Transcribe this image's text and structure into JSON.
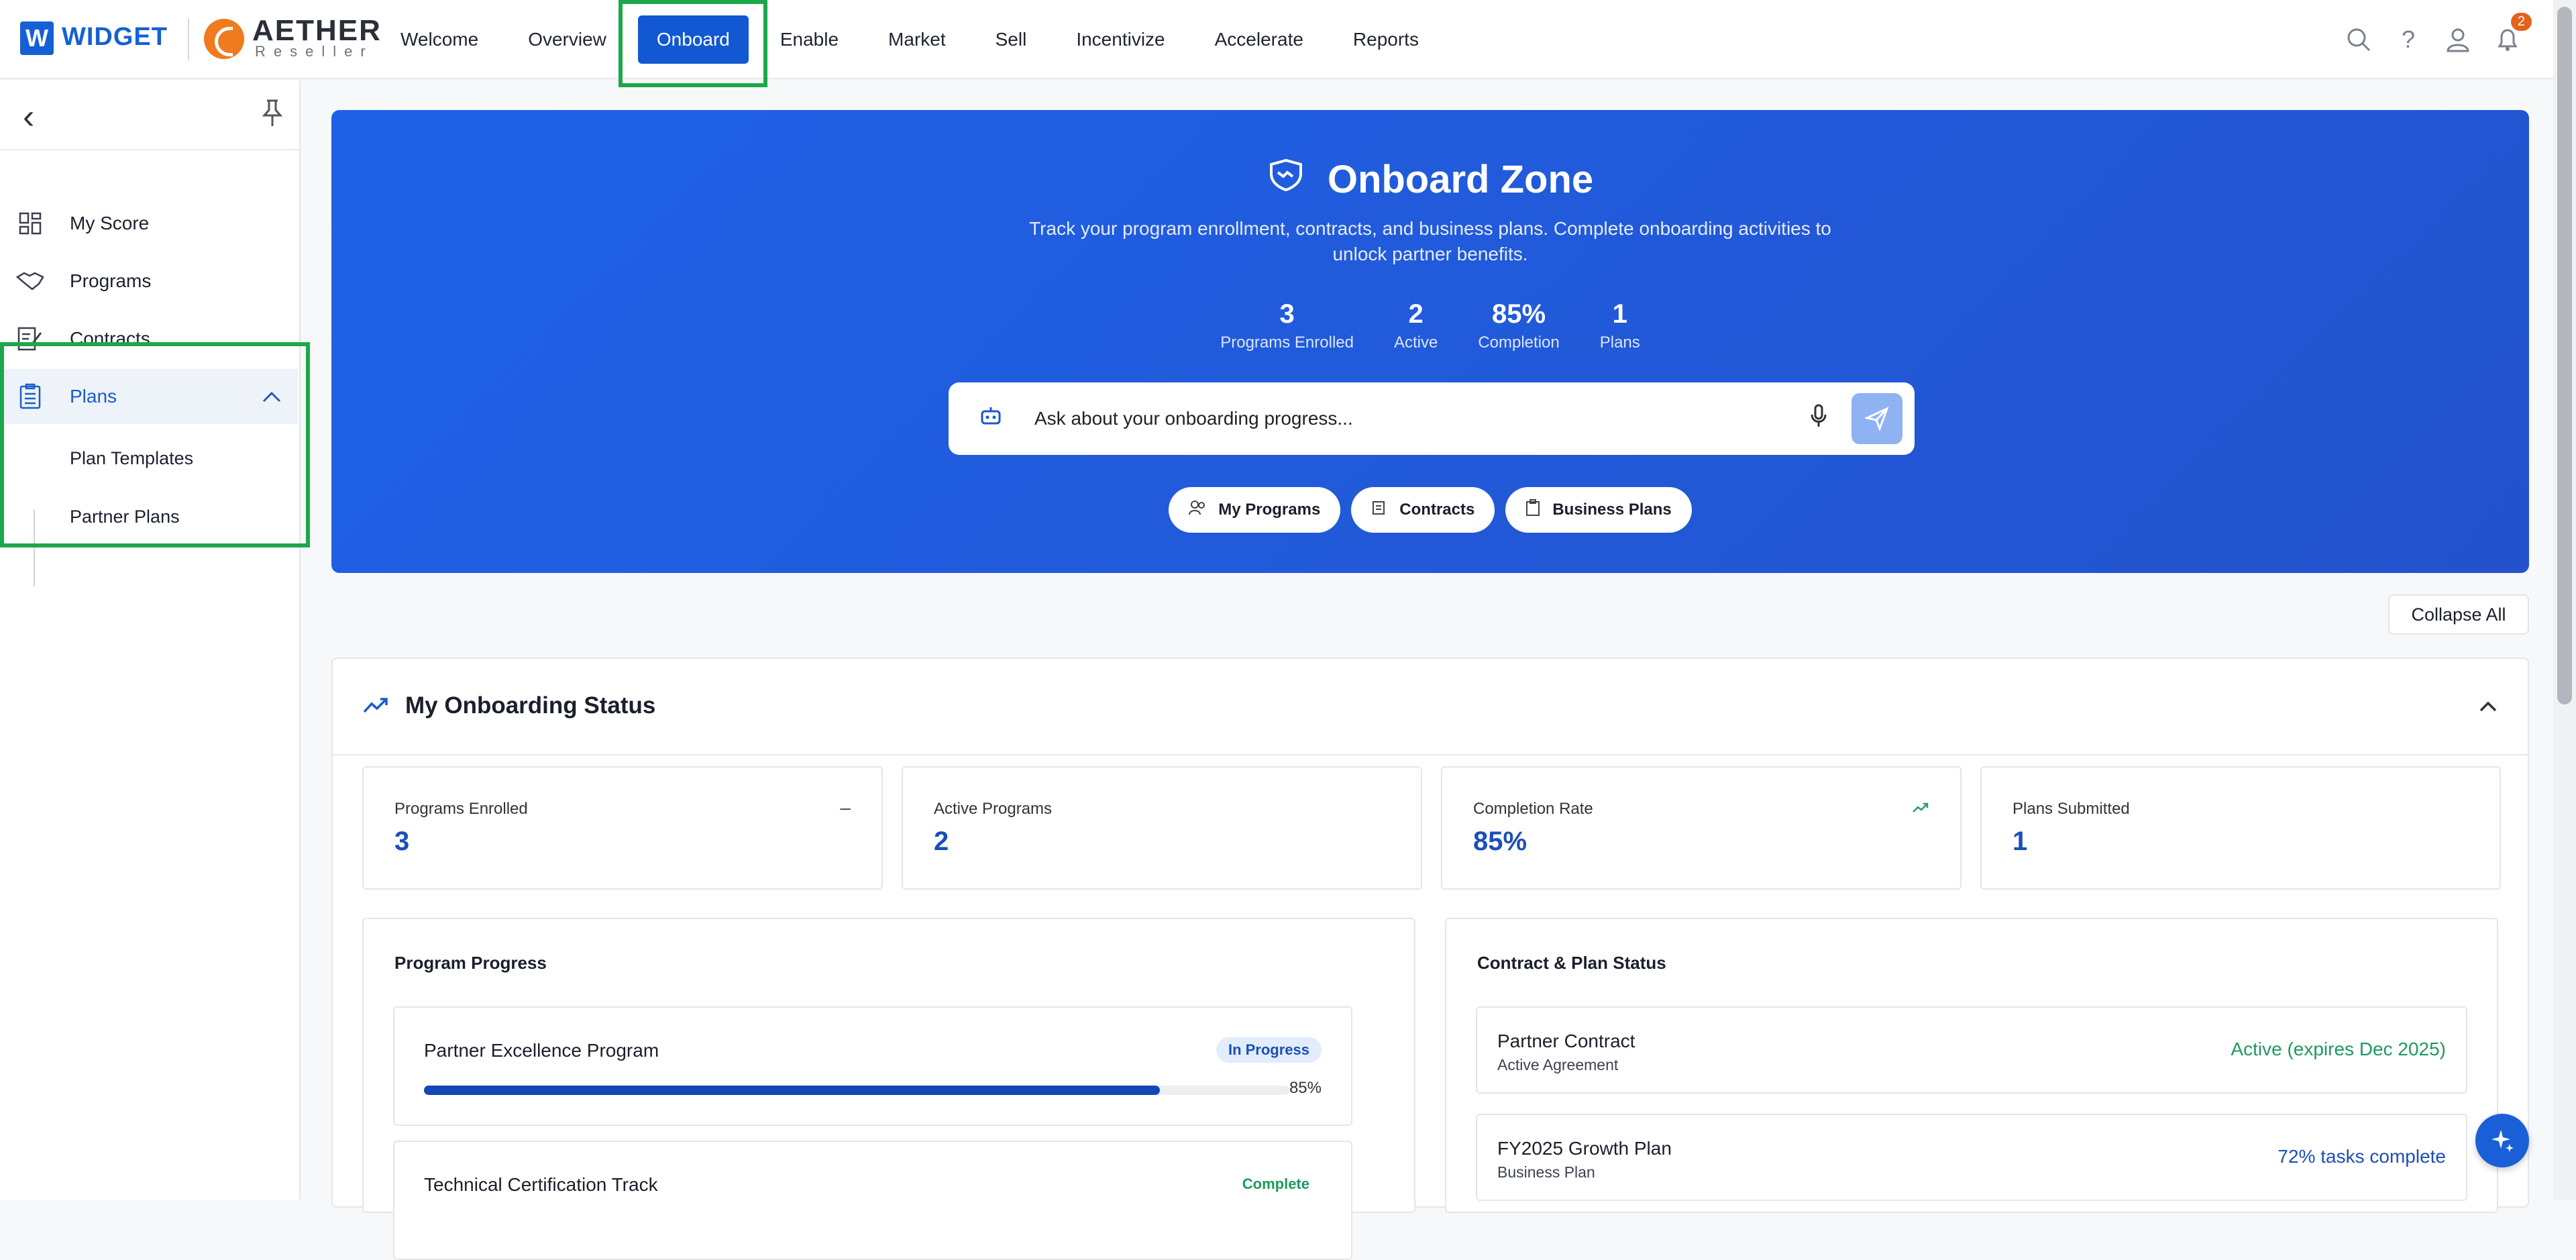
{
  "brand": {
    "widget_letter": "W",
    "widget_name": "WIDGET",
    "aether_name": "AETHER",
    "aether_sub": "Reseller"
  },
  "nav": {
    "items": [
      {
        "label": "Welcome"
      },
      {
        "label": "Overview"
      },
      {
        "label": "Onboard",
        "active": true
      },
      {
        "label": "Enable"
      },
      {
        "label": "Market"
      },
      {
        "label": "Sell"
      },
      {
        "label": "Incentivize"
      },
      {
        "label": "Accelerate"
      },
      {
        "label": "Reports"
      }
    ],
    "notification_count": "2"
  },
  "sidebar": {
    "items": [
      {
        "label": "My Score",
        "icon": "dashboard-icon"
      },
      {
        "label": "Programs",
        "icon": "handshake-icon"
      },
      {
        "label": "Contracts",
        "icon": "contract-icon"
      },
      {
        "label": "Plans",
        "icon": "clipboard-icon"
      }
    ],
    "subitems": [
      {
        "label": "Plan Templates"
      },
      {
        "label": "Partner Plans"
      }
    ]
  },
  "hero": {
    "title": "Onboard Zone",
    "description": "Track your program enrollment, contracts, and business plans. Complete onboarding activities to unlock partner benefits.",
    "stats": [
      {
        "value": "3",
        "label": "Programs Enrolled"
      },
      {
        "value": "2",
        "label": "Active"
      },
      {
        "value": "85%",
        "label": "Completion"
      },
      {
        "value": "1",
        "label": "Plans"
      }
    ],
    "search_placeholder": "Ask about your onboarding progress...",
    "chips": [
      {
        "label": "My Programs",
        "icon": "users-icon"
      },
      {
        "label": "Contracts",
        "icon": "scroll-icon"
      },
      {
        "label": "Business Plans",
        "icon": "clipboard-icon"
      }
    ]
  },
  "collapse_all": "Collapse All",
  "status": {
    "title": "My Onboarding Status",
    "metrics": [
      {
        "label": "Programs Enrolled",
        "value": "3",
        "icon": "–"
      },
      {
        "label": "Active Programs",
        "value": "2",
        "icon": ""
      },
      {
        "label": "Completion Rate",
        "value": "85%",
        "icon": "trend-up"
      },
      {
        "label": "Plans Submitted",
        "value": "1",
        "icon": ""
      }
    ],
    "program_progress": {
      "title": "Program Progress",
      "items": [
        {
          "name": "Partner Excellence Program",
          "status": "In Progress",
          "progress": 85,
          "progress_label": "85%"
        },
        {
          "name": "Technical Certification Track",
          "status": "Complete"
        }
      ]
    },
    "contract_plan": {
      "title": "Contract & Plan Status",
      "items": [
        {
          "name": "Partner Contract",
          "sub": "Active Agreement",
          "status": "Active (expires Dec 2025)",
          "color": "#1c9a5e"
        },
        {
          "name": "FY2025 Growth Plan",
          "sub": "Business Plan",
          "status": "72% tasks complete",
          "color": "#1a4fb8"
        }
      ]
    }
  },
  "colors": {
    "accent": "#1358d3",
    "highlight": "#1ca84a",
    "hero_start": "#1f62e8",
    "hero_end": "#2352cc"
  }
}
